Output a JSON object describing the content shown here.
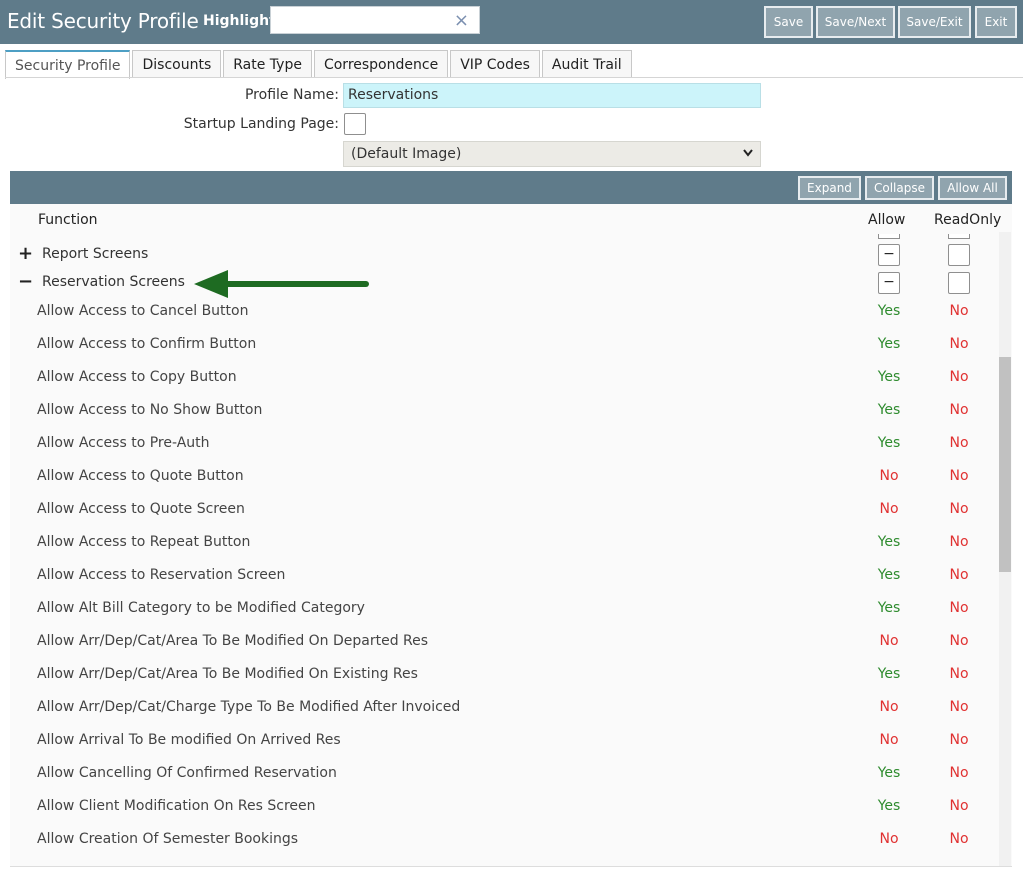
{
  "header": {
    "title": "Edit Security Profile",
    "highlight_label": "Highlight:",
    "highlight_value": "",
    "clear_glyph": "×",
    "buttons": {
      "save": "Save",
      "save_next": "Save/Next",
      "save_exit": "Save/Exit",
      "exit": "Exit"
    }
  },
  "tabs": [
    "Security Profile",
    "Discounts",
    "Rate Type",
    "Correspondence",
    "VIP Codes",
    "Audit Trail"
  ],
  "active_tab": "Security Profile",
  "form": {
    "profile_name_label": "Profile Name:",
    "profile_name_value": "Reservations",
    "startup_label": "Startup Landing Page:",
    "image_select_value": "(Default Image)"
  },
  "panel": {
    "buttons": {
      "expand": "Expand",
      "collapse": "Collapse",
      "allow_all": "Allow All"
    },
    "columns": {
      "function": "Function",
      "allow": "Allow",
      "readonly": "ReadOnly"
    }
  },
  "groups": [
    {
      "label": "Report Screens",
      "toggle": "+",
      "allow_state": "−",
      "readonly_state": ""
    },
    {
      "label": "Reservation Screens",
      "toggle": "−",
      "allow_state": "−",
      "readonly_state": ""
    }
  ],
  "rows": [
    {
      "function": "Allow Access to Cancel Button",
      "allow": "Yes",
      "readonly": "No"
    },
    {
      "function": "Allow Access to Confirm Button",
      "allow": "Yes",
      "readonly": "No"
    },
    {
      "function": "Allow Access to Copy Button",
      "allow": "Yes",
      "readonly": "No"
    },
    {
      "function": "Allow Access to No Show Button",
      "allow": "Yes",
      "readonly": "No"
    },
    {
      "function": "Allow Access to Pre-Auth",
      "allow": "Yes",
      "readonly": "No"
    },
    {
      "function": "Allow Access to Quote Button",
      "allow": "No",
      "readonly": "No"
    },
    {
      "function": "Allow Access to Quote Screen",
      "allow": "No",
      "readonly": "No"
    },
    {
      "function": "Allow Access to Repeat Button",
      "allow": "Yes",
      "readonly": "No"
    },
    {
      "function": "Allow Access to Reservation Screen",
      "allow": "Yes",
      "readonly": "No"
    },
    {
      "function": "Allow Alt Bill Category to be Modified Category",
      "allow": "Yes",
      "readonly": "No"
    },
    {
      "function": "Allow Arr/Dep/Cat/Area To Be Modified On Departed Res",
      "allow": "No",
      "readonly": "No"
    },
    {
      "function": "Allow Arr/Dep/Cat/Area To Be Modified On Existing Res",
      "allow": "Yes",
      "readonly": "No"
    },
    {
      "function": "Allow Arr/Dep/Cat/Charge Type To Be Modified After Invoiced",
      "allow": "No",
      "readonly": "No"
    },
    {
      "function": "Allow Arrival To Be modified On Arrived Res",
      "allow": "No",
      "readonly": "No"
    },
    {
      "function": "Allow Cancelling Of Confirmed Reservation",
      "allow": "Yes",
      "readonly": "No"
    },
    {
      "function": "Allow Client Modification On Res Screen",
      "allow": "Yes",
      "readonly": "No"
    },
    {
      "function": "Allow Creation Of Semester Bookings",
      "allow": "No",
      "readonly": "No"
    }
  ],
  "colors": {
    "header": "#5f7b8a",
    "button": "#90a4ae",
    "yes": "#2e8b2e",
    "no": "#e03131",
    "arrow": "#1e6b22",
    "input_bg": "#ccf4fa"
  }
}
